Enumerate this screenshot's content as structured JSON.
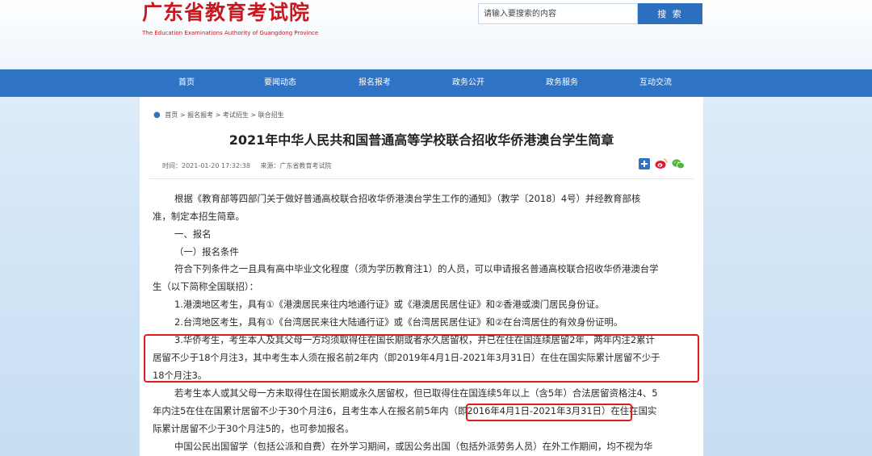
{
  "header": {
    "title": "广东省教育考试院",
    "subtitle": "The Education Examinations Authority of Guangdong Province",
    "accent": "#c8171e"
  },
  "search": {
    "placeholder": "请输入要搜索的内容",
    "button_label": "搜 索"
  },
  "nav": {
    "items": [
      "首页",
      "要闻动态",
      "报名报考",
      "政务公开",
      "政务服务",
      "互动交流"
    ],
    "color": "#2f73c5"
  },
  "breadcrumb": [
    "首页",
    "报名报考",
    "考试招生",
    "联合招生"
  ],
  "article": {
    "title": "2021年中华人民共和国普通高等学校联合招收华侨港澳台学生简章",
    "time": "时间：2021-01-20 17:32:38",
    "source": "来源：广东省教育考试院",
    "lines": [
      "根据《教育部等四部门关于做好普通高校联合招收华侨港澳台学生工作的通知》（教学〔2018〕4号）并经教育部核",
      "准，制定本招生简章。",
      "一、报名",
      "（一）报名条件",
      "符合下列条件之一且具有高中毕业文化程度（须为学历教育注1）的人员，可以申请报名普通高校联合招收华侨港澳台学",
      "生（以下简称全国联招）：",
      "1.港澳地区考生，具有①《港澳居民来往内地通行证》或《港澳居民居住证》和②香港或澳门居民身份证。",
      "2.台湾地区考生，具有①《台湾居民来往大陆通行证》或《台湾居民居住证》和②在台湾居住的有效身份证明。",
      "3.华侨考生，考生本人及其父母一方均须取得住在国长期或者永久居留权，并已在住在国连续居留2年，两年内注2累计",
      "居留不少于18个月注3，其中考生本人须在报名前2年内（即2019年4月1日-2021年3月31日）在住在国实际累计居留不少于",
      "18个月注3。",
      "若考生本人或其父母一方未取得住在国长期或永久居留权，但已取得住在国连续5年以上（含5年）合法居留资格注4、5",
      "年内注5在住在国累计居留不少于30个月注6，且考生本人在报名前5年内（即2016年4月1日-2021年3月31日）在住在国实",
      "际累计居留不少于30个月注5的，也可参加报名。",
      "中国公民出国留学（包括公派和自费）在外学习期间，或因公务出国（包括外派劳务人员）在外工作期间，均不视为华"
    ],
    "highlight_color": "#e01b1b"
  }
}
